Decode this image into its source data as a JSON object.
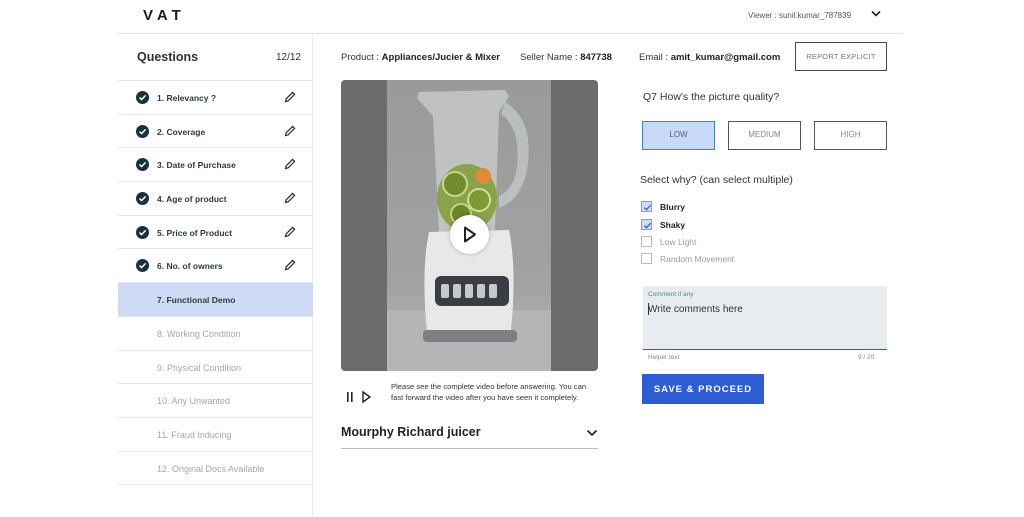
{
  "app": {
    "logo": "VAT",
    "viewer": "Viewer : sunil.kumar_787839"
  },
  "sidebar": {
    "title": "Questions",
    "count": "12/12",
    "items": [
      {
        "label": "1. Relevancy ?",
        "done": true
      },
      {
        "label": "2. Coverage",
        "done": true
      },
      {
        "label": "3. Date of Purchase",
        "done": true
      },
      {
        "label": "4. Age of product",
        "done": true
      },
      {
        "label": "5. Price of Product",
        "done": true
      },
      {
        "label": "6. No. of owners",
        "done": true
      },
      {
        "label": "7. Functional Demo",
        "done": false,
        "active": true
      },
      {
        "label": "8. Working Condition",
        "done": false
      },
      {
        "label": "9. Physical Condition",
        "done": false
      },
      {
        "label": "10. Any Unwanted",
        "done": false
      },
      {
        "label": "11. Fraud Inducing",
        "done": false
      },
      {
        "label": "12. Original Docs Available",
        "done": false
      }
    ]
  },
  "product_info": {
    "product_label": "Product : ",
    "product_value": "Appliances/Jucier & Mixer",
    "seller_label": "Seller Name : ",
    "seller_value": "847738",
    "email_label": "Email : ",
    "email_value": "amit_kumar@gmail.com",
    "report_button": "REPORT EXPLICIT"
  },
  "video": {
    "note": "Please see the complete video before answering. You can fast forward the video after you have seen it completely."
  },
  "product": {
    "name": "Mourphy Richard juicer"
  },
  "question": {
    "title": "Q7 How's the picture quality?",
    "options": [
      "LOW",
      "MEDIUM",
      "HIGH"
    ],
    "selected": "LOW",
    "why_title": "Select why? (can select multiple)",
    "reasons": [
      {
        "label": "Blurry",
        "checked": true
      },
      {
        "label": "Shaky",
        "checked": true
      },
      {
        "label": "Low Light",
        "checked": false
      },
      {
        "label": "Random Movement",
        "checked": false
      }
    ],
    "comment_label": "Comment if any",
    "comment_placeholder": "Write comments here",
    "helper_text": "Helper text",
    "counter": "9 / 20",
    "save_button": "SAVE & PROCEED"
  },
  "colors": {
    "accent": "#2d5cd3",
    "selected_bg": "#c8d9f8",
    "active_row": "#cfdbf5",
    "check": "#16323b"
  }
}
